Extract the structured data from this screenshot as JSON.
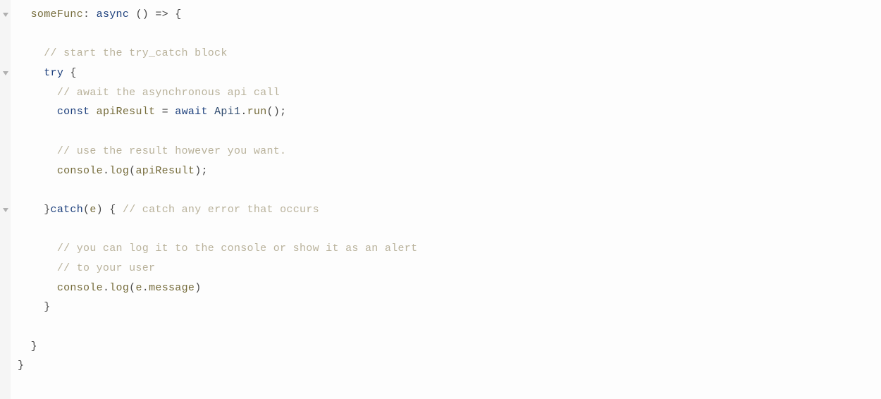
{
  "code": {
    "lines": [
      {
        "indent": 1,
        "fold": true,
        "tokens": [
          {
            "t": "someFunc",
            "c": "func"
          },
          {
            "t": ": ",
            "c": "punct"
          },
          {
            "t": "async",
            "c": "keyword"
          },
          {
            "t": " () ",
            "c": "punct"
          },
          {
            "t": "=>",
            "c": "op"
          },
          {
            "t": " {",
            "c": "punct"
          }
        ]
      },
      {
        "indent": 0,
        "fold": false,
        "tokens": []
      },
      {
        "indent": 2,
        "fold": false,
        "tokens": [
          {
            "t": "// start the try_catch block",
            "c": "comment"
          }
        ]
      },
      {
        "indent": 2,
        "fold": true,
        "tokens": [
          {
            "t": "try",
            "c": "keyword"
          },
          {
            "t": " {",
            "c": "punct"
          }
        ]
      },
      {
        "indent": 3,
        "fold": false,
        "tokens": [
          {
            "t": "// await the asynchronous api call",
            "c": "comment"
          }
        ]
      },
      {
        "indent": 3,
        "fold": false,
        "tokens": [
          {
            "t": "const",
            "c": "keyword"
          },
          {
            "t": " ",
            "c": "punct"
          },
          {
            "t": "apiResult",
            "c": "ident"
          },
          {
            "t": " = ",
            "c": "op"
          },
          {
            "t": "await",
            "c": "keyword"
          },
          {
            "t": " ",
            "c": "punct"
          },
          {
            "t": "Api1",
            "c": "class"
          },
          {
            "t": ".",
            "c": "punct"
          },
          {
            "t": "run",
            "c": "prop"
          },
          {
            "t": "();",
            "c": "punct"
          }
        ]
      },
      {
        "indent": 0,
        "fold": false,
        "tokens": []
      },
      {
        "indent": 3,
        "fold": false,
        "tokens": [
          {
            "t": "// use the result however you want.",
            "c": "comment"
          }
        ]
      },
      {
        "indent": 3,
        "fold": false,
        "tokens": [
          {
            "t": "console",
            "c": "ident"
          },
          {
            "t": ".",
            "c": "punct"
          },
          {
            "t": "log",
            "c": "prop"
          },
          {
            "t": "(",
            "c": "punct"
          },
          {
            "t": "apiResult",
            "c": "ident"
          },
          {
            "t": ");",
            "c": "punct"
          }
        ]
      },
      {
        "indent": 0,
        "fold": false,
        "tokens": []
      },
      {
        "indent": 2,
        "fold": true,
        "tokens": [
          {
            "t": "}",
            "c": "punct"
          },
          {
            "t": "catch",
            "c": "keyword"
          },
          {
            "t": "(",
            "c": "punct"
          },
          {
            "t": "e",
            "c": "ident"
          },
          {
            "t": ") { ",
            "c": "punct"
          },
          {
            "t": "// catch any error that occurs",
            "c": "comment"
          }
        ]
      },
      {
        "indent": 0,
        "fold": false,
        "tokens": []
      },
      {
        "indent": 3,
        "fold": false,
        "tokens": [
          {
            "t": "// you can log it to the console or show it as an alert",
            "c": "comment"
          }
        ]
      },
      {
        "indent": 3,
        "fold": false,
        "tokens": [
          {
            "t": "// to your user",
            "c": "comment"
          }
        ]
      },
      {
        "indent": 3,
        "fold": false,
        "tokens": [
          {
            "t": "console",
            "c": "ident"
          },
          {
            "t": ".",
            "c": "punct"
          },
          {
            "t": "log",
            "c": "prop"
          },
          {
            "t": "(",
            "c": "punct"
          },
          {
            "t": "e",
            "c": "ident"
          },
          {
            "t": ".",
            "c": "punct"
          },
          {
            "t": "message",
            "c": "prop"
          },
          {
            "t": ")",
            "c": "punct"
          }
        ]
      },
      {
        "indent": 2,
        "fold": false,
        "tokens": [
          {
            "t": "}",
            "c": "punct"
          }
        ]
      },
      {
        "indent": 0,
        "fold": false,
        "tokens": []
      },
      {
        "indent": 1,
        "fold": false,
        "tokens": [
          {
            "t": "}",
            "c": "punct"
          }
        ]
      },
      {
        "indent": 0,
        "fold": false,
        "tokens": [
          {
            "t": "}",
            "c": "punct"
          }
        ]
      }
    ],
    "indentUnit": "  "
  }
}
